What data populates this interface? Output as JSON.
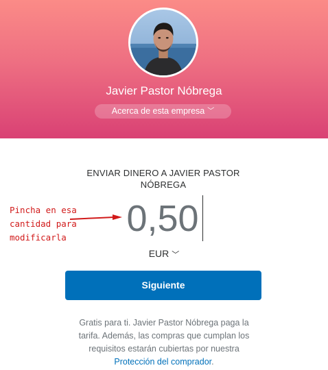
{
  "profile": {
    "name": "Javier Pastor Nóbrega",
    "about_label": "Acerca de esta empresa",
    "about_icon": "chevron-down-icon"
  },
  "payment": {
    "title": "ENVIAR DINERO A JAVIER PASTOR NÓBREGA",
    "amount": "0,50",
    "currency": "EUR",
    "currency_icon": "chevron-down-icon",
    "next_label": "Siguiente"
  },
  "annotation": {
    "text": "Pincha en esa cantidad para modificarla",
    "color": "#d11a1a"
  },
  "footer": {
    "text": "Gratis para ti. Javier Pastor Nóbrega paga la tarifa. Además, las compras que cumplan los requisitos estarán cubiertas por nuestra",
    "link_label": "Protección del comprador",
    "end": "."
  },
  "colors": {
    "header_top": "#fb8b87",
    "header_bottom": "#d94174",
    "button": "#0070ba",
    "link": "#0070ba",
    "amount_text": "#6c7378"
  }
}
